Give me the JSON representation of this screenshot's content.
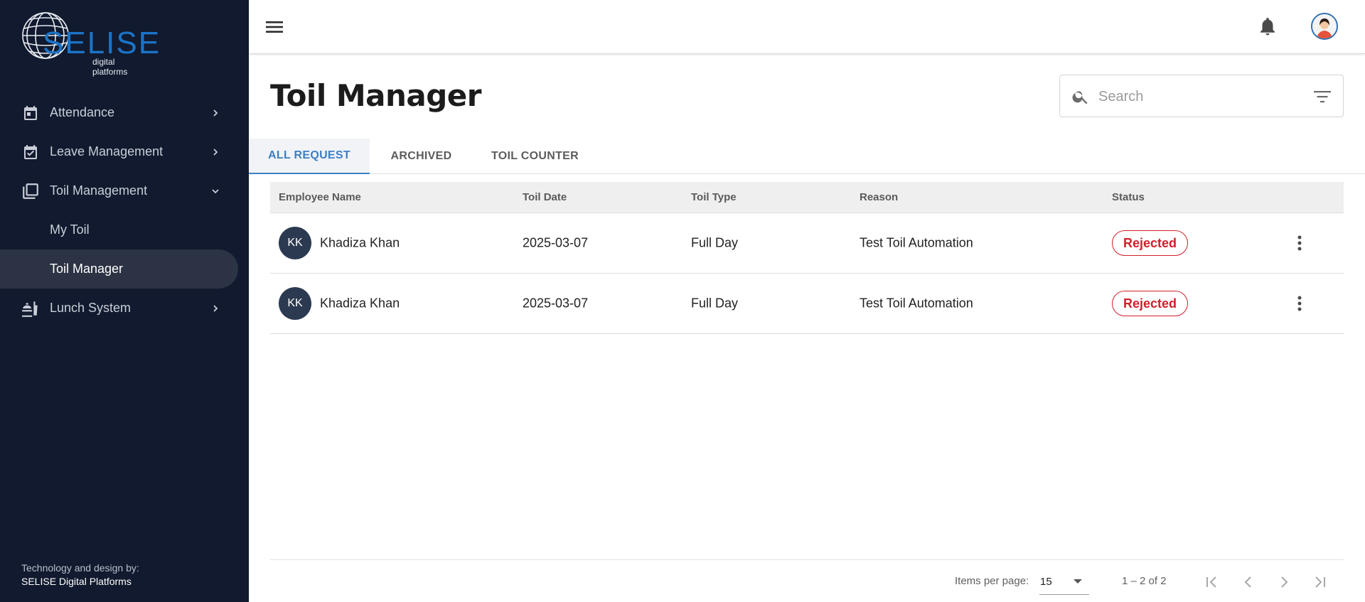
{
  "brand": {
    "name": "SELISE",
    "tagline": "digital platforms"
  },
  "sidebar": {
    "items": [
      {
        "label": "Attendance",
        "icon": "calendar-icon",
        "expanded": false
      },
      {
        "label": "Leave Management",
        "icon": "calendar-check-icon",
        "expanded": false
      },
      {
        "label": "Toil Management",
        "icon": "library-icon",
        "expanded": true,
        "children": [
          {
            "label": "My Toil"
          },
          {
            "label": "Toil Manager",
            "active": true
          }
        ]
      },
      {
        "label": "Lunch System",
        "icon": "food-icon",
        "expanded": false
      }
    ],
    "credit_line1": "Technology and design by:",
    "credit_line2": "SELISE Digital Platforms"
  },
  "header": {
    "title": "Toil Manager"
  },
  "search": {
    "placeholder": "Search"
  },
  "tabs": [
    {
      "label": "ALL REQUEST",
      "active": true
    },
    {
      "label": "ARCHIVED"
    },
    {
      "label": "TOIL COUNTER"
    }
  ],
  "table": {
    "columns": [
      "Employee Name",
      "Toil Date",
      "Toil Type",
      "Reason",
      "Status"
    ],
    "rows": [
      {
        "initials": "KK",
        "name": "Khadiza Khan",
        "date": "2025-03-07",
        "type": "Full Day",
        "reason": "Test Toil Automation",
        "status": "Rejected"
      },
      {
        "initials": "KK",
        "name": "Khadiza Khan",
        "date": "2025-03-07",
        "type": "Full Day",
        "reason": "Test Toil Automation",
        "status": "Rejected"
      }
    ]
  },
  "pagination": {
    "items_per_page_label": "Items per page:",
    "items_per_page": "15",
    "range": "1 – 2 of 2"
  },
  "colors": {
    "sidebar_bg": "#111a2e",
    "accent": "#3c7fc3",
    "rejected": "#d11f2a",
    "avatar_bg": "#2b3a50"
  }
}
